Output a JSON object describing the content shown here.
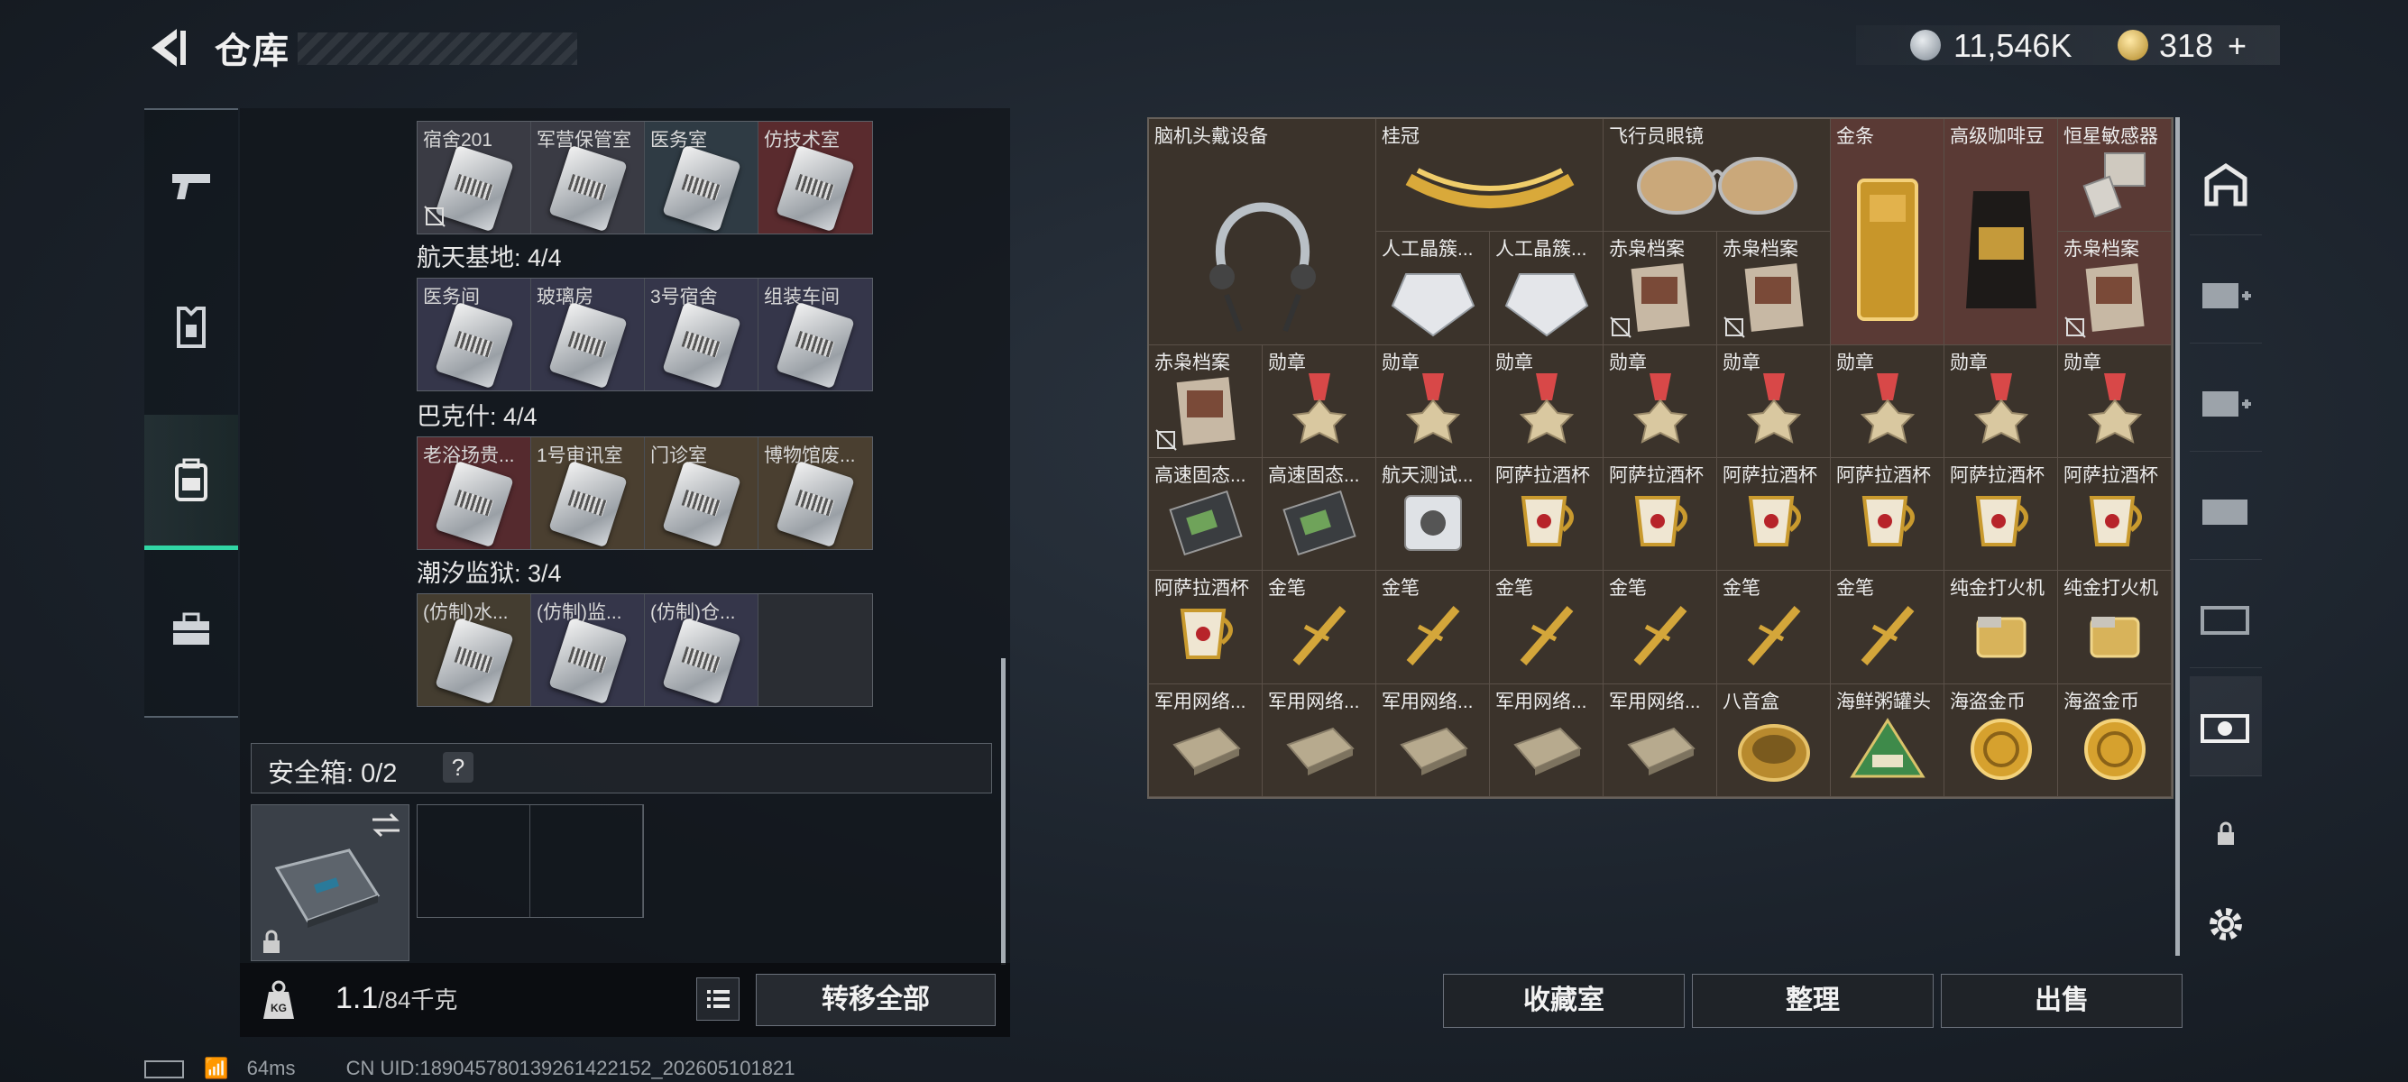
{
  "header": {
    "title": "仓库",
    "currency1": "11,546K",
    "currency2": "318",
    "plus_label": "+"
  },
  "left_nav": [
    "gun-icon",
    "armor-icon",
    "backpack-icon",
    "toolbox-icon"
  ],
  "key_sections": [
    {
      "label": null,
      "rows": [
        "宿舍201",
        "军营保管室",
        "医务室",
        "仿技术室"
      ]
    },
    {
      "label": "航天基地: 4/4",
      "rows": [
        "医务间",
        "玻璃房",
        "3号宿舍",
        "组装车间"
      ]
    },
    {
      "label": "巴克什: 4/4",
      "rows": [
        "老浴场贵...",
        "1号审讯室",
        "门诊室",
        "博物馆废..."
      ]
    },
    {
      "label": "潮汐监狱: 3/4",
      "rows": [
        "(仿制)水...",
        "(仿制)监...",
        "(仿制)仓...",
        ""
      ]
    }
  ],
  "safe_box": {
    "label": "安全箱: 0/2",
    "help": "?"
  },
  "weight": {
    "current": "1.1",
    "max": "/84千克"
  },
  "buttons": {
    "transfer_all": "转移全部",
    "collection": "收藏室",
    "organize": "整理",
    "sell": "出售"
  },
  "inventory": {
    "row1": [
      "脑机头戴设备",
      "桂冠",
      "",
      "飞行员眼镜",
      "",
      "金条",
      "高级咖啡豆",
      "恒星敏感器"
    ],
    "row2": [
      "人工晶簇...",
      "人工晶簇...",
      "赤枭档案",
      "赤枭档案",
      "赤枭档案"
    ],
    "row3": [
      "赤枭档案",
      "勋章",
      "勋章",
      "勋章",
      "勋章",
      "勋章",
      "勋章",
      "勋章",
      "勋章"
    ],
    "row4": [
      "高速固态...",
      "高速固态...",
      "航天测试...",
      "阿萨拉酒杯",
      "阿萨拉酒杯",
      "阿萨拉酒杯",
      "阿萨拉酒杯",
      "阿萨拉酒杯",
      "阿萨拉酒杯"
    ],
    "row5": [
      "阿萨拉酒杯",
      "金笔",
      "金笔",
      "金笔",
      "金笔",
      "金笔",
      "金笔",
      "纯金打火机",
      "纯金打火机"
    ],
    "row6": [
      "军用网络...",
      "军用网络...",
      "军用网络...",
      "军用网络...",
      "军用网络...",
      "八音盒",
      "海鲜粥罐头",
      "海盗金币",
      "海盗金币"
    ]
  },
  "status": {
    "ping": "64ms",
    "uid": "CN UID:1890457801392614221​52_202605101821"
  }
}
